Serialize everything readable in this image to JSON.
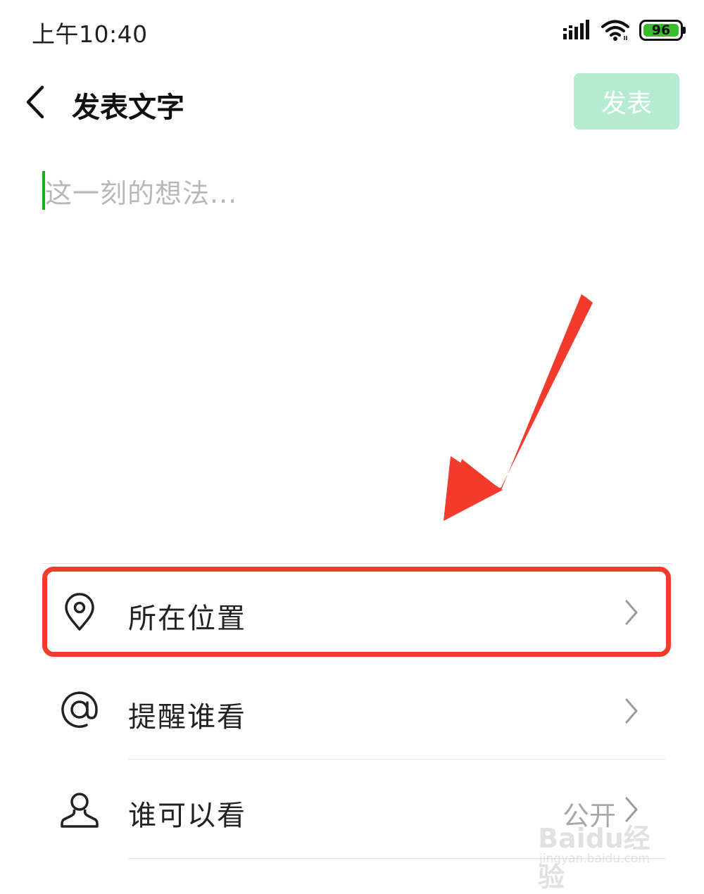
{
  "status_bar": {
    "time": "上午10:40",
    "battery": "96",
    "icons": [
      "signal-icon",
      "wifi-icon",
      "battery-icon"
    ],
    "battery_color": "#3dbb2e"
  },
  "header": {
    "title": "发表文字",
    "publish_label": "发表",
    "publish_color": "#b5ebd1"
  },
  "composer": {
    "placeholder": "这一刻的想法..."
  },
  "options": [
    {
      "label": "所在位置",
      "icon": "location-pin-icon",
      "value": ""
    },
    {
      "label": "提醒谁看",
      "icon": "at-icon",
      "value": ""
    },
    {
      "label": "谁可以看",
      "icon": "person-icon",
      "value": "公开"
    }
  ],
  "annotation": {
    "highlight_color": "#f23b2b"
  },
  "watermark": {
    "brand": "Baidu经验",
    "url": "jingyan.baidu.com"
  }
}
